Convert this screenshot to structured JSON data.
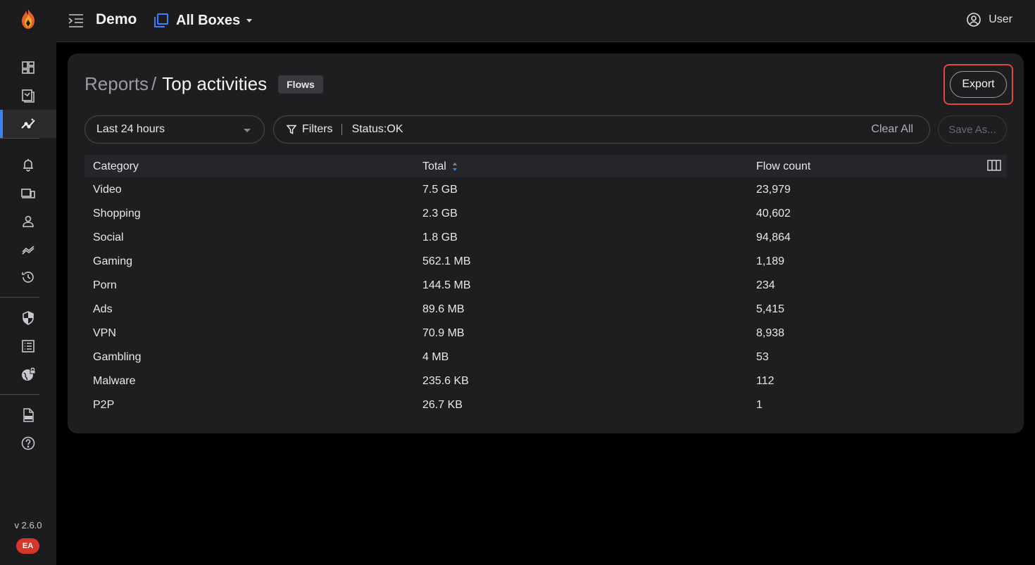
{
  "topbar": {
    "app_title": "Demo",
    "box_selector_label": "All Boxes",
    "user_label": "User"
  },
  "sidebar": {
    "items": [
      {
        "icon": "dashboard-icon"
      },
      {
        "icon": "devices-list-icon"
      },
      {
        "icon": "reports-icon",
        "active": true
      },
      {
        "icon": "bell-icon"
      },
      {
        "icon": "devices-icon"
      },
      {
        "icon": "user-icon"
      },
      {
        "icon": "trends-icon"
      },
      {
        "icon": "history-icon"
      },
      {
        "icon": "shield-icon"
      },
      {
        "icon": "rules-list-icon"
      },
      {
        "icon": "globe-lock-icon"
      },
      {
        "icon": "api-doc-icon"
      },
      {
        "icon": "help-icon"
      }
    ],
    "version": "v 2.6.0",
    "badge": "EA"
  },
  "page": {
    "breadcrumb_parent": "Reports",
    "breadcrumb_separator": "/",
    "breadcrumb_current": "Top activities",
    "type_badge": "Flows",
    "export_label": "Export",
    "time_range": "Last 24 hours",
    "filters_label": "Filters",
    "filter_chip": "Status:OK",
    "clear_all_label": "Clear All",
    "save_as_label": "Save As..."
  },
  "table": {
    "headers": [
      "Category",
      "Total",
      "Flow count"
    ],
    "sorted_column": "Total",
    "rows": [
      [
        "Video",
        "7.5 GB",
        "23,979"
      ],
      [
        "Shopping",
        "2.3 GB",
        "40,602"
      ],
      [
        "Social",
        "1.8 GB",
        "94,864"
      ],
      [
        "Gaming",
        "562.1 MB",
        "1,189"
      ],
      [
        "Porn",
        "144.5 MB",
        "234"
      ],
      [
        "Ads",
        "89.6 MB",
        "5,415"
      ],
      [
        "VPN",
        "70.9 MB",
        "8,938"
      ],
      [
        "Gambling",
        "4 MB",
        "53"
      ],
      [
        "Malware",
        "235.6 KB",
        "112"
      ],
      [
        "P2P",
        "26.7 KB",
        "1"
      ]
    ]
  },
  "colors": {
    "accent": "#3b82f6",
    "highlight_border": "#e04a3e",
    "badge_bg": "#d9362b"
  }
}
